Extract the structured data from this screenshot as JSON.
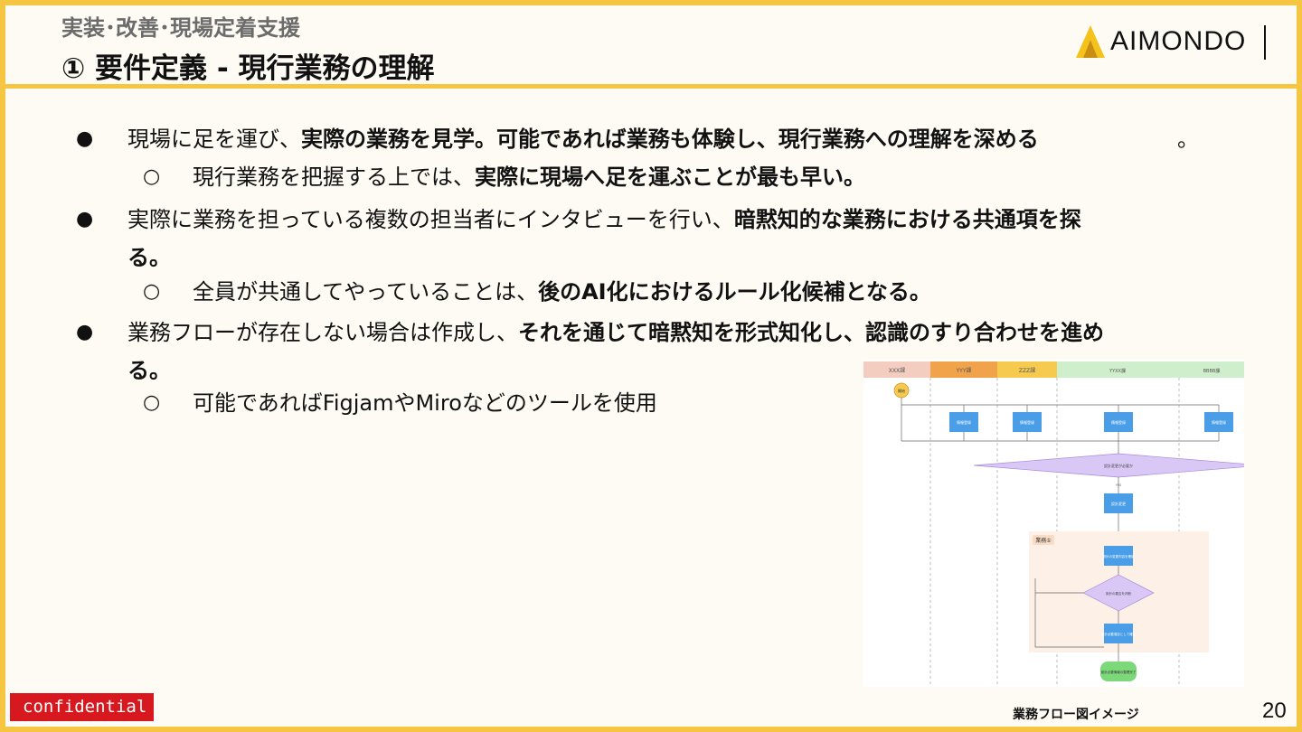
{
  "header": {
    "subtitle": "実装･改善･現場定着支援",
    "title": "① 要件定義 - 現行業務の理解",
    "logo_text": "AIMONDO"
  },
  "bullets": [
    {
      "level": 1,
      "marker": "●",
      "lines": [
        {
          "plain": "現場に足を運び、",
          "bold": "実際の業務を見学。可能であれば業務も体験し、現行業務への理解を深める",
          "tail": "。"
        }
      ]
    },
    {
      "level": 2,
      "marker": "○",
      "lines": [
        {
          "plain": "現行業務を把握する上では、",
          "bold": "実際に現場へ足を運ぶことが最も早い。"
        }
      ]
    },
    {
      "level": 1,
      "marker": "●",
      "lines": [
        {
          "plain": "実際に業務を担っている複数の担当者にインタビューを行い、",
          "bold": "暗黙知的な業務における共通項を探"
        },
        {
          "bold": "る。"
        }
      ]
    },
    {
      "level": 2,
      "marker": "○",
      "lines": [
        {
          "plain": "全員が共通してやっていることは、",
          "bold": "後のAI化におけるルール化候補となる。"
        }
      ]
    },
    {
      "level": 1,
      "marker": "●",
      "lines": [
        {
          "plain": "業務フローが存在しない場合は作成し、",
          "bold": "それを通じて暗黙知を形式知化し、認識のすり合わせを進め"
        },
        {
          "bold": "る。"
        }
      ]
    },
    {
      "level": 2,
      "marker": "○",
      "lines": [
        {
          "plain": "可能であればFigjamやMiroなどのツールを使用"
        }
      ]
    }
  ],
  "diagram": {
    "lanes": [
      "XXX課",
      "YYY課",
      "ZZZ課",
      "YYXX課",
      "BBBB課"
    ],
    "lane_colors": [
      "#f3cdbf",
      "#f0a34b",
      "#f6c94f",
      "#cfeecb",
      "#cfeecb"
    ],
    "start_label": "開始",
    "task_label": "情報登録",
    "decision_label": "設計変更が必要か",
    "yes_label": "YES",
    "change_label": "設計変更",
    "group_label": "業務①",
    "sub_task1": "設計の変更内容を確認",
    "sub_decision": "設計の要否を判断",
    "sub_task2": "設計必要項目として確定",
    "end_label": "設計必要情報の整理完了"
  },
  "caption": "業務フロー図イメージ",
  "page_number": "20",
  "confidential": "confidential"
}
